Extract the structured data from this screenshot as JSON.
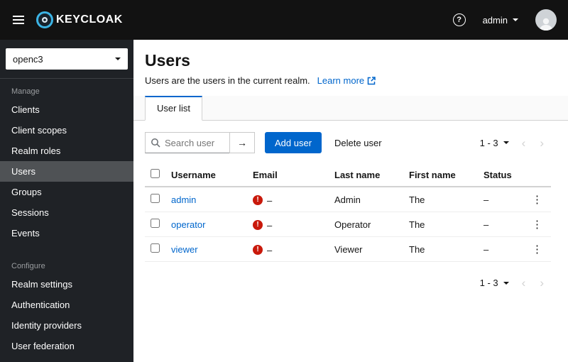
{
  "topbar": {
    "brand": "KEYCLOAK",
    "username": "admin"
  },
  "sidebar": {
    "realm": "openc3",
    "sections": [
      {
        "label": "Manage",
        "items": [
          {
            "label": "Clients"
          },
          {
            "label": "Client scopes"
          },
          {
            "label": "Realm roles"
          },
          {
            "label": "Users"
          },
          {
            "label": "Groups"
          },
          {
            "label": "Sessions"
          },
          {
            "label": "Events"
          }
        ]
      },
      {
        "label": "Configure",
        "items": [
          {
            "label": "Realm settings"
          },
          {
            "label": "Authentication"
          },
          {
            "label": "Identity providers"
          },
          {
            "label": "User federation"
          }
        ]
      }
    ]
  },
  "page": {
    "title": "Users",
    "description": "Users are the users in the current realm.",
    "learn_more": "Learn more"
  },
  "tabs": {
    "user_list": "User list"
  },
  "toolbar": {
    "search_placeholder": "Search user",
    "add_user_label": "Add user",
    "delete_user_label": "Delete user"
  },
  "pagination": {
    "range": "1 - 3"
  },
  "table": {
    "headers": {
      "username": "Username",
      "email": "Email",
      "last_name": "Last name",
      "first_name": "First name",
      "status": "Status"
    },
    "empty_value": "–",
    "rows": [
      {
        "username": "admin",
        "last_name": "Admin",
        "first_name": "The"
      },
      {
        "username": "operator",
        "last_name": "Operator",
        "first_name": "The"
      },
      {
        "username": "viewer",
        "last_name": "Viewer",
        "first_name": "The"
      }
    ]
  },
  "icons": {
    "help": "?",
    "arrow_right": "→",
    "kebab": "⋮",
    "prev": "‹",
    "next": "›",
    "exclamation": "!"
  },
  "colors": {
    "primary": "#0066cc",
    "link": "#0066cc",
    "danger": "#c9190b",
    "masthead": "#121212",
    "sidebar": "#1f2226"
  }
}
